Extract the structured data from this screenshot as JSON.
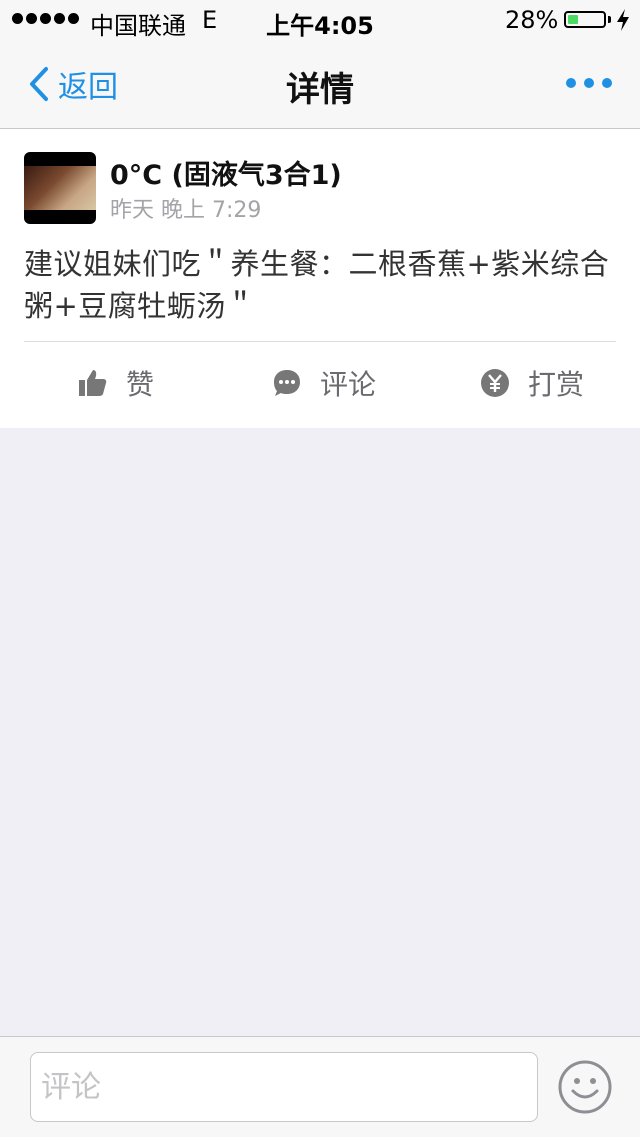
{
  "status_bar": {
    "carrier": "中国联通",
    "network": "E",
    "time": "上午4:05",
    "battery_percent": "28%",
    "battery_level": 0.28,
    "battery_color": "#4cd964"
  },
  "nav": {
    "back_label": "返回",
    "title": "详情",
    "more_icon": "more-dots-icon",
    "accent": "#1f90e4"
  },
  "post": {
    "author": "0°C  (固液气3合1)",
    "time": "昨天 晚上 7:29",
    "content": "建议姐妹们吃＂养生餐：二根香蕉+紫米综合粥+豆腐牡蛎汤＂"
  },
  "actions": {
    "like_label": "赞",
    "comment_label": "评论",
    "reward_label": "打赏"
  },
  "comment_bar": {
    "placeholder": "评论",
    "emoji_icon": "smiley-icon"
  }
}
